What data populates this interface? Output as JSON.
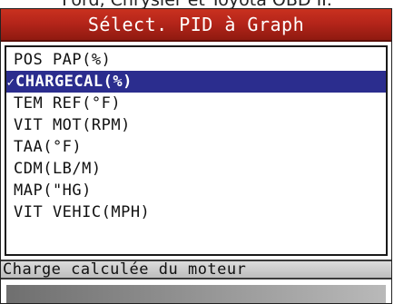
{
  "caption": "Ford, Chrysler et Toyota OBD II.",
  "screen": {
    "title": "Sélect. PID à Graph",
    "selected_marker": "✓",
    "items": [
      {
        "label": "POS PAP(%)",
        "selected": false
      },
      {
        "label": "CHARGECAL(%)",
        "selected": true
      },
      {
        "label": "TEM REF(°F)",
        "selected": false
      },
      {
        "label": "VIT MOT(RPM)",
        "selected": false
      },
      {
        "label": "TAA(°F)",
        "selected": false
      },
      {
        "label": "CDM(LB/M)",
        "selected": false
      },
      {
        "label": "MAP(\"HG)",
        "selected": false
      },
      {
        "label": "VIT VEHIC(MPH)",
        "selected": false
      }
    ],
    "status": "Charge calculée du moteur"
  },
  "colors": {
    "title_bar": "#b5251a",
    "selection": "#2b2d8e"
  }
}
